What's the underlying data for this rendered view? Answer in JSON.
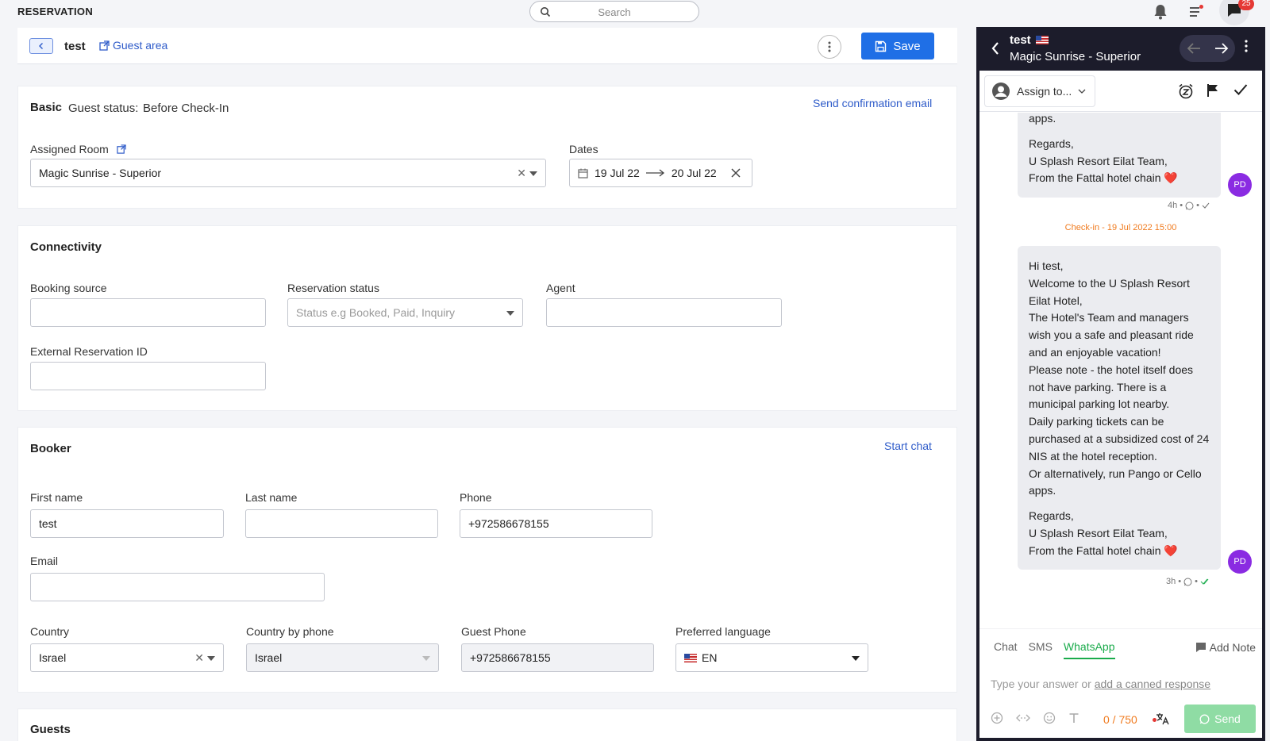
{
  "app": {
    "title": "RESERVATION"
  },
  "search": {
    "placeholder": "Search"
  },
  "notifications": {
    "badge_count": "25"
  },
  "header": {
    "name": "test",
    "guest_area": "Guest area",
    "save": "Save"
  },
  "basic": {
    "title": "Basic",
    "guest_status_label": "Guest status:",
    "guest_status_value": "Before Check-In",
    "send_confirmation": "Send confirmation email",
    "assigned_room_label": "Assigned Room",
    "assigned_room_value": "Magic Sunrise - Superior",
    "dates_label": "Dates",
    "date_from": "19 Jul 22",
    "date_to": "20 Jul 22"
  },
  "connectivity": {
    "title": "Connectivity",
    "booking_source_label": "Booking source",
    "booking_source_value": "",
    "reservation_status_label": "Reservation status",
    "reservation_status_placeholder": "Status e.g Booked, Paid, Inquiry",
    "agent_label": "Agent",
    "agent_value": "",
    "external_id_label": "External Reservation ID",
    "external_id_value": ""
  },
  "booker": {
    "title": "Booker",
    "start_chat": "Start chat",
    "first_name_label": "First name",
    "first_name_value": "test",
    "last_name_label": "Last name",
    "last_name_value": "",
    "phone_label": "Phone",
    "phone_value": "+972586678155",
    "email_label": "Email",
    "email_value": "",
    "country_label": "Country",
    "country_value": "Israel",
    "country_by_phone_label": "Country by phone",
    "country_by_phone_value": "Israel",
    "guest_phone_label": "Guest Phone",
    "guest_phone_value": "+972586678155",
    "preferred_language_label": "Preferred language",
    "preferred_language_value": "EN"
  },
  "guests": {
    "title": "Guests"
  },
  "chat": {
    "guest_name": "test",
    "room": "Magic Sunrise - Superior",
    "assign_label": "Assign to...",
    "msg1": {
      "lines": [
        "apps.",
        "",
        "Regards,",
        "U Splash Resort Eilat Team,",
        "From the Fattal hotel chain ❤️"
      ],
      "time": "4h"
    },
    "checkin_note": "Check-in - 19 Jul 2022 15:00",
    "msg2": {
      "lines": [
        "Hi test,",
        "Welcome to the U Splash Resort",
        "Eilat Hotel,",
        "The Hotel's Team and managers",
        "wish you a safe and pleasant ride",
        "and an enjoyable vacation!",
        "Please note - the hotel itself does",
        "not have parking. There is a",
        "municipal parking lot nearby.",
        "Daily parking tickets can be",
        "purchased at a subsidized cost of 24",
        "NIS at the hotel reception.",
        "Or alternatively, run Pango or Cello",
        "apps.",
        "",
        "Regards,",
        "U Splash Resort Eilat Team,",
        "From the Fattal hotel chain ❤️"
      ],
      "time": "3h"
    },
    "avatar_initials": "PD",
    "tabs": [
      "Chat",
      "SMS",
      "WhatsApp"
    ],
    "active_tab": "WhatsApp",
    "add_note": "Add Note",
    "reply_placeholder": "Type your answer or",
    "canned_response": "add a canned response",
    "counter": "0 / 750",
    "send": "Send"
  }
}
